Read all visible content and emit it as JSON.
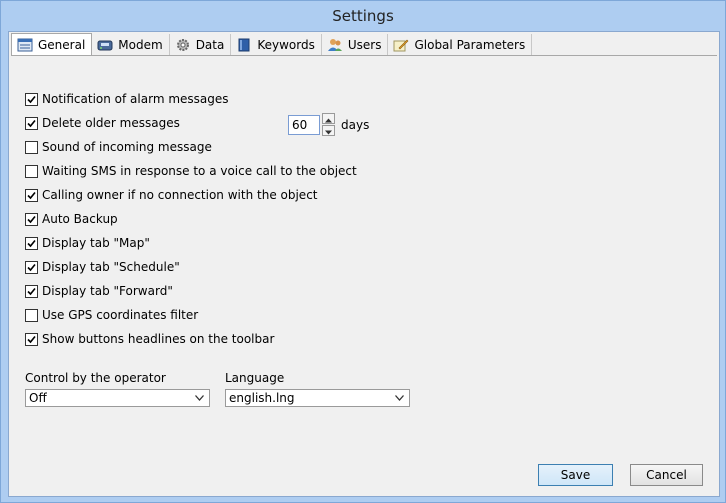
{
  "window": {
    "title": "Settings"
  },
  "tabs": [
    {
      "label": "General",
      "icon": "general-icon",
      "active": true
    },
    {
      "label": "Modem",
      "icon": "modem-icon"
    },
    {
      "label": "Data",
      "icon": "gear-icon"
    },
    {
      "label": "Keywords",
      "icon": "book-icon"
    },
    {
      "label": "Users",
      "icon": "users-icon"
    },
    {
      "label": "Global Parameters",
      "icon": "pencil-icon"
    }
  ],
  "options": [
    {
      "label": "Notification of alarm messages",
      "checked": true
    },
    {
      "label": "Delete older messages",
      "checked": true
    },
    {
      "label": "Sound of incoming message",
      "checked": false
    },
    {
      "label": "Waiting SMS in response to a voice call to the object",
      "checked": false
    },
    {
      "label": "Calling owner if no connection with the object",
      "checked": true
    },
    {
      "label": "Auto Backup",
      "checked": true
    },
    {
      "label": "Display tab \"Map\"",
      "checked": true
    },
    {
      "label": "Display tab \"Schedule\"",
      "checked": true
    },
    {
      "label": "Display tab \"Forward\"",
      "checked": true
    },
    {
      "label": "Use GPS coordinates filter",
      "checked": false
    },
    {
      "label": "Show buttons headlines on the toolbar",
      "checked": true
    }
  ],
  "delete_days": {
    "value": "60",
    "unit": "days"
  },
  "operator_control": {
    "label": "Control by the operator",
    "value": "Off"
  },
  "language": {
    "label": "Language",
    "value": "english.lng"
  },
  "buttons": {
    "save": "Save",
    "cancel": "Cancel"
  }
}
